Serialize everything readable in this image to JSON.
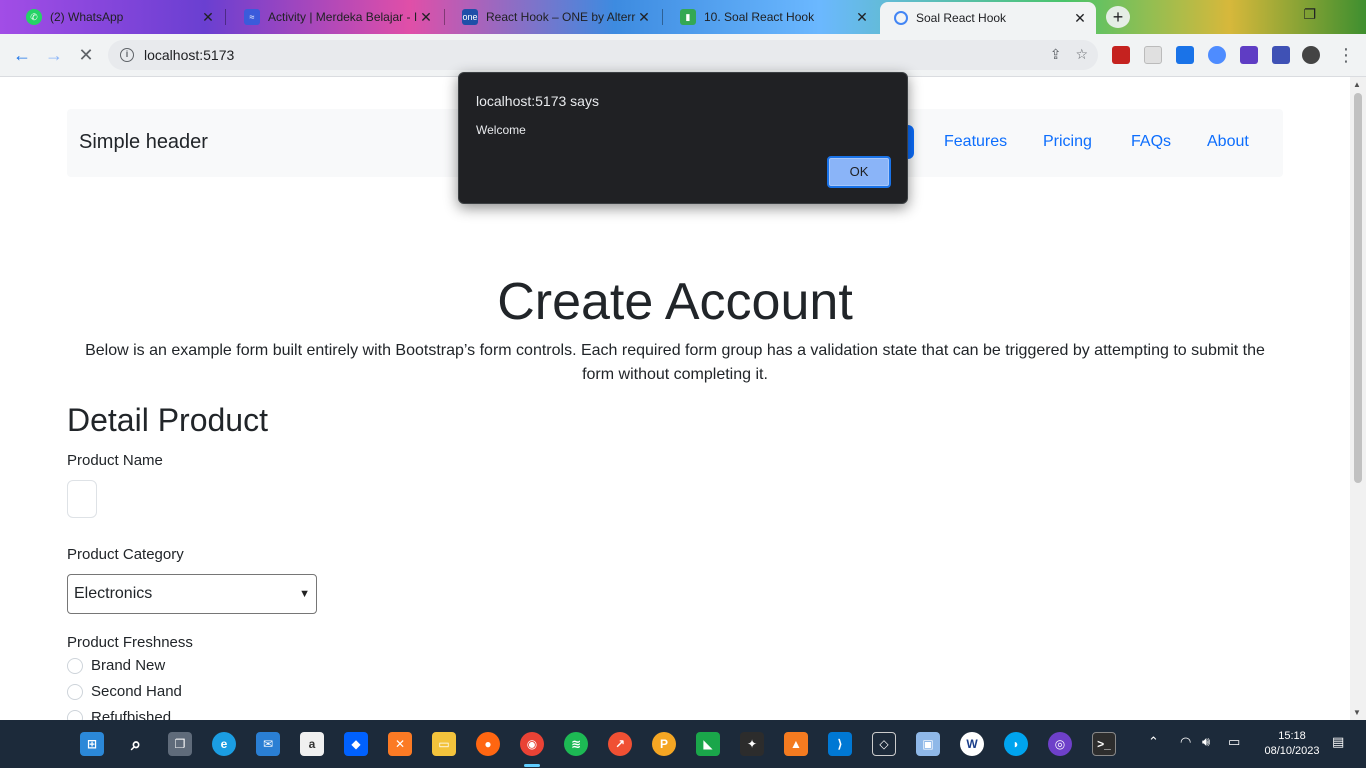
{
  "browser": {
    "tabs": [
      {
        "title": "(2) WhatsApp",
        "icon": "whatsapp-icon",
        "color": "#25d366"
      },
      {
        "title": "Activity | Merdeka Belajar - I",
        "icon": "kampus-merdeka-icon",
        "color": "#3b5bdb"
      },
      {
        "title": "React Hook – ONE by Alterr",
        "icon": "one-alterra-icon",
        "color": "#1f4fa8"
      },
      {
        "title": "10. Soal React Hook",
        "icon": "book-icon",
        "color": "#34a853"
      },
      {
        "title": "Soal React Hook",
        "icon": "loading-icon",
        "color": "#4285f4"
      }
    ],
    "new_tab_symbol": "+",
    "url": "localhost:5173"
  },
  "page": {
    "header": {
      "brand": "Simple header",
      "nav": [
        "Features",
        "Pricing",
        "FAQs",
        "About"
      ]
    },
    "hero": {
      "title": "Create Account",
      "lead": "Below is an example form built entirely with Bootstrap’s form controls. Each required form group has a validation state that can be triggered by attempting to submit the form without completing it."
    },
    "form": {
      "section_title": "Detail Product",
      "product_name_label": "Product Name",
      "product_name_value": "",
      "category_label": "Product Category",
      "category_selected": "Electronics",
      "freshness_label": "Product Freshness",
      "freshness_options": [
        "Brand New",
        "Second Hand",
        "Refufbished"
      ]
    }
  },
  "dialog": {
    "title": "localhost:5173 says",
    "message": "Welcome",
    "ok_label": "OK"
  },
  "taskbar": {
    "time": "15:18",
    "date": "08/10/2023"
  }
}
